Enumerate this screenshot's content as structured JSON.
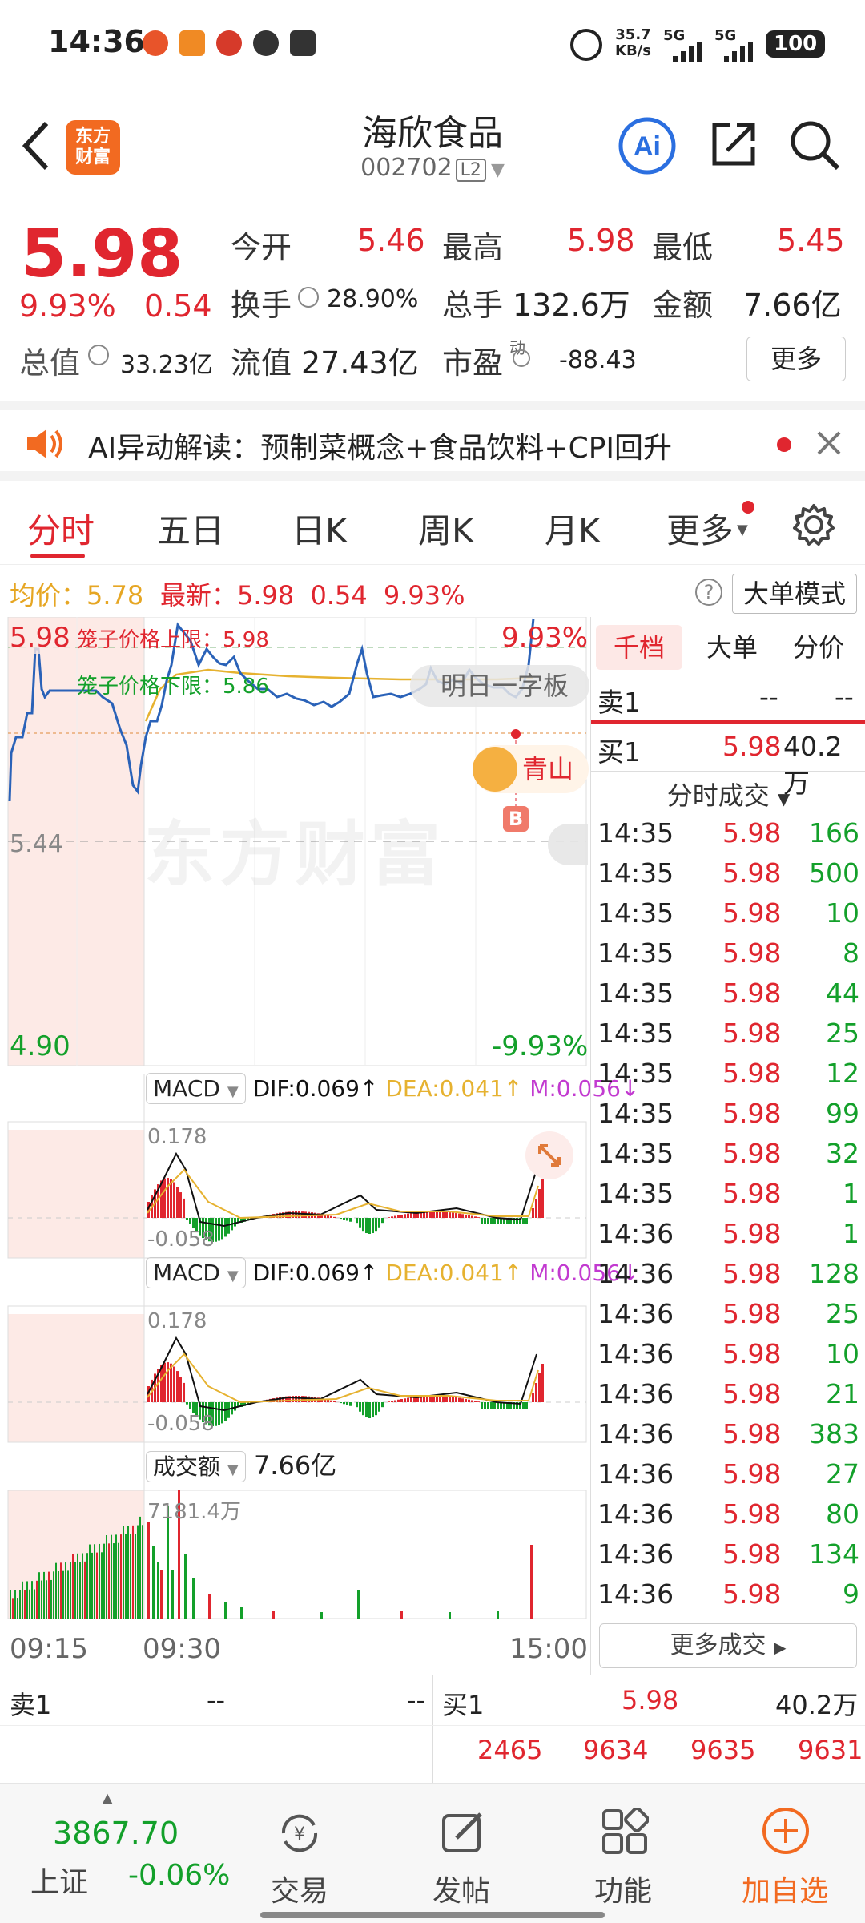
{
  "status": {
    "time": "14:36",
    "net_speed": "35.7",
    "net_unit": "KB/s",
    "signal1": "5G",
    "signal2": "5G",
    "battery": "100"
  },
  "header": {
    "logo_line1": "东方",
    "logo_line2": "财富",
    "title": "海欣食品",
    "code": "002702",
    "level": "L2"
  },
  "quote": {
    "price": "5.98",
    "change_pct": "9.93%",
    "change": "0.54",
    "open_label": "今开",
    "open": "5.46",
    "high_label": "最高",
    "high": "5.98",
    "low_label": "最低",
    "low": "5.45",
    "turnover_label": "换手",
    "turnover": "28.90%",
    "volume_label": "总手",
    "volume": "132.6万",
    "amount_label": "金额",
    "amount": "7.66亿",
    "mktcap_label": "总值",
    "mktcap": "33.23亿",
    "float_label": "流值",
    "float": "27.43亿",
    "pe_label": "市盈",
    "pe_sup": "动",
    "pe": "-88.43",
    "more": "更多"
  },
  "news": {
    "text": "AI异动解读：预制菜概念+食品饮料+CPI回升"
  },
  "tabs": [
    "分时",
    "五日",
    "日K",
    "周K",
    "月K",
    "更多"
  ],
  "infobar": {
    "avg_label": "均价：",
    "avg": "5.78",
    "latest_label": "最新：",
    "latest": "5.98",
    "change": "0.54",
    "change_pct": "9.93%",
    "mode": "大单模式"
  },
  "chart": {
    "price_top": "5.98",
    "pct_top": "9.93%",
    "price_mid": "5.44",
    "price_bottom": "4.90",
    "pct_bottom": "-9.93%",
    "upper_limit": "笼子价格上限：5.98",
    "lower_limit": "笼子价格下限：5.86",
    "next_day": "明日一字板",
    "avatar_text": "青山",
    "watermark": "东方财富",
    "b_marker": "B",
    "macd1": {
      "name": "MACD",
      "dif": "DIF:0.069",
      "dea": "DEA:0.041",
      "m": "M:0.056",
      "top": "0.178",
      "bottom": "-0.058"
    },
    "macd2": {
      "name": "MACD",
      "dif": "DIF:0.069",
      "dea": "DEA:0.041",
      "m": "M:0.056",
      "top": "0.178",
      "bottom": "-0.058"
    },
    "vol": {
      "name": "成交额",
      "value": "7.66亿",
      "max": "7181.4万"
    },
    "time_start": "09:15",
    "time_mid": "09:30",
    "time_end": "15:00"
  },
  "side": {
    "tabs": [
      "千档",
      "大单",
      "分价"
    ],
    "sell1_label": "卖1",
    "sell1_price": "--",
    "sell1_vol": "--",
    "buy1_label": "买1",
    "buy1_price": "5.98",
    "buy1_vol": "40.2万",
    "ticks_title": "分时成交",
    "ticks": [
      [
        "14:35",
        "5.98",
        "166"
      ],
      [
        "14:35",
        "5.98",
        "500"
      ],
      [
        "14:35",
        "5.98",
        "10"
      ],
      [
        "14:35",
        "5.98",
        "8"
      ],
      [
        "14:35",
        "5.98",
        "44"
      ],
      [
        "14:35",
        "5.98",
        "25"
      ],
      [
        "14:35",
        "5.98",
        "12"
      ],
      [
        "14:35",
        "5.98",
        "99"
      ],
      [
        "14:35",
        "5.98",
        "32"
      ],
      [
        "14:35",
        "5.98",
        "1"
      ],
      [
        "14:36",
        "5.98",
        "1"
      ],
      [
        "14:36",
        "5.98",
        "128"
      ],
      [
        "14:36",
        "5.98",
        "25"
      ],
      [
        "14:36",
        "5.98",
        "10"
      ],
      [
        "14:36",
        "5.98",
        "21"
      ],
      [
        "14:36",
        "5.98",
        "383"
      ],
      [
        "14:36",
        "5.98",
        "27"
      ],
      [
        "14:36",
        "5.98",
        "80"
      ],
      [
        "14:36",
        "5.98",
        "134"
      ],
      [
        "14:36",
        "5.98",
        "9"
      ]
    ],
    "more_ticks": "更多成交"
  },
  "book": {
    "sell1_label": "卖1",
    "sell1_price": "--",
    "sell1_vol": "--",
    "buy1_label": "买1",
    "buy1_price": "5.98",
    "buy1_vol": "40.2万",
    "queue": [
      "2465",
      "9634",
      "9635",
      "9631"
    ]
  },
  "nav": {
    "index_value": "3867.70",
    "index_name": "上证",
    "index_change": "-0.06%",
    "items": [
      "交易",
      "发帖",
      "功能",
      "加自选"
    ]
  },
  "colors": {
    "up": "#e0262f",
    "down": "#13a02a",
    "price_line": "#2a62b8",
    "avg_line": "#e6b230",
    "accent": "#f26a21"
  }
}
